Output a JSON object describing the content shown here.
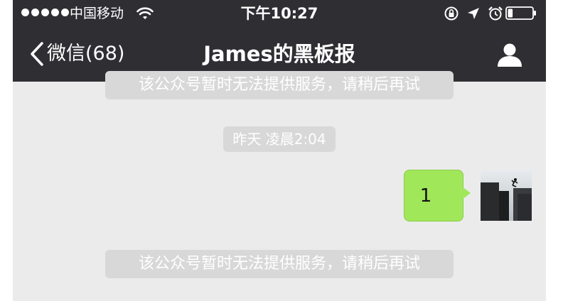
{
  "status_bar": {
    "carrier": "中国移动",
    "time": "下午10:27",
    "signal_bars": 5,
    "battery_level": 0.2
  },
  "nav": {
    "back_label": "微信(68)",
    "title": "James的黑板报"
  },
  "messages": {
    "system_notice_top": "该公众号暂时无法提供服务，请稍后再试",
    "timestamp": "昨天 凌晨2:04",
    "sent_text": "1",
    "system_notice_bottom": "该公众号暂时无法提供服务，请稍后再试"
  },
  "colors": {
    "nav_bg": "#2f2e33",
    "chat_bg": "#ebebeb",
    "bubble_green": "#a0e75a",
    "pill_bg": "#d8d8d8"
  },
  "icons": {
    "back": "chevron-left-icon",
    "profile": "person-icon",
    "wifi": "wifi-icon",
    "lock": "rotation-lock-icon",
    "location": "location-arrow-icon",
    "alarm": "alarm-clock-icon",
    "battery": "battery-icon"
  }
}
